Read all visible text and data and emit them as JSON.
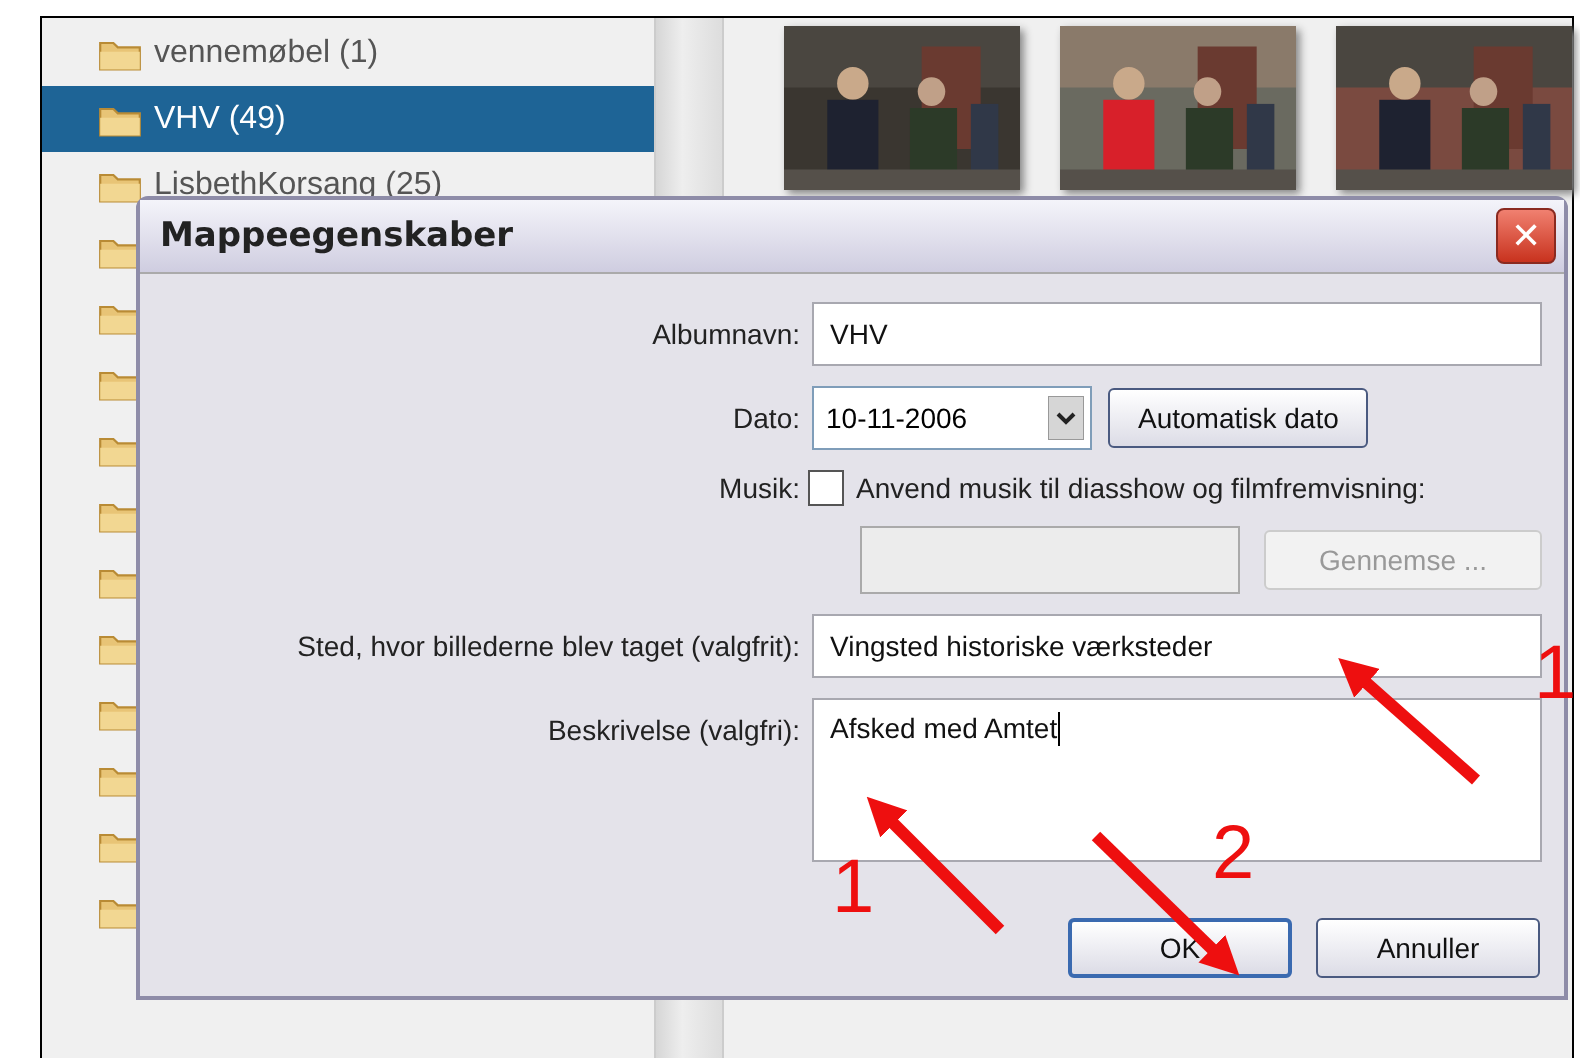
{
  "folder_tree": {
    "items": [
      {
        "label": "vennemøbel (1)",
        "selected": false,
        "kind": "named"
      },
      {
        "label": "VHV (49)",
        "selected": true,
        "kind": "named"
      },
      {
        "label": "LisbethKorsang (25)",
        "selected": false,
        "kind": "named"
      },
      {
        "kind": "covered",
        "selected": false
      },
      {
        "kind": "covered",
        "selected": false
      },
      {
        "kind": "covered",
        "selected": false
      },
      {
        "kind": "covered",
        "selected": false
      },
      {
        "kind": "covered",
        "selected": false
      },
      {
        "kind": "covered",
        "selected": false
      },
      {
        "kind": "covered",
        "selected": false
      },
      {
        "kind": "covered",
        "selected": false
      },
      {
        "kind": "covered",
        "selected": false
      },
      {
        "kind": "covered",
        "selected": false
      },
      {
        "kind": "covered",
        "selected": false
      }
    ]
  },
  "dialog": {
    "title": "Mappeegenskaber",
    "close": "✕",
    "album_name": {
      "label": "Albumnavn:",
      "value": "VHV"
    },
    "date": {
      "label": "Dato:",
      "value": "10-11-2006",
      "button": "Automatisk dato"
    },
    "music": {
      "label": "Musik:",
      "checked": false,
      "text": "Anvend musik til diasshow og filmfremvisning:",
      "browse": "Gennemse ...",
      "disabled": true
    },
    "place": {
      "label": "Sted, hvor billederne blev taget (valgfrit):",
      "value": "Vingsted historiske værksteder"
    },
    "description": {
      "label": "Beskrivelse (valgfri):",
      "value": "Afsked med Amtet"
    },
    "buttons": [
      {
        "label": "OK",
        "default": true
      },
      {
        "label": "Annuller",
        "default": false
      }
    ]
  },
  "annotations": [
    {
      "label": "1"
    },
    {
      "label": "1"
    },
    {
      "label": "2"
    }
  ]
}
